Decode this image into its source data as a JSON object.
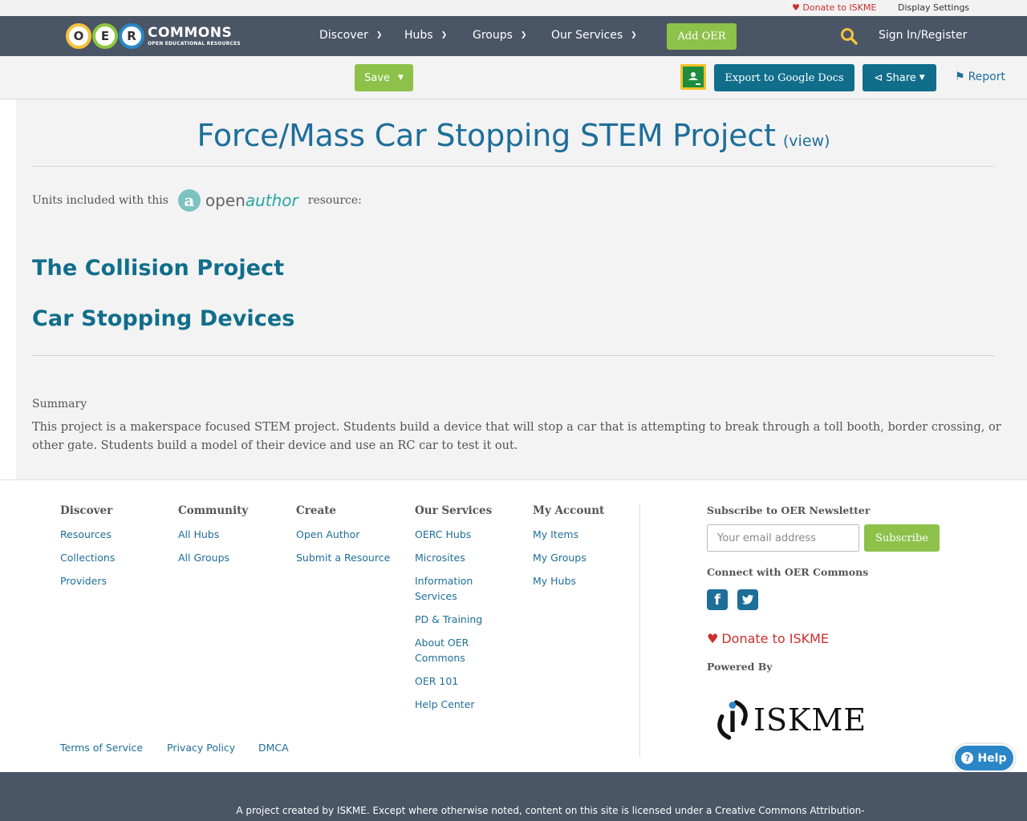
{
  "utility": {
    "donate_label": "Donate to ISKME",
    "display_settings_label": "Display Settings"
  },
  "brand": {
    "logo_letters": [
      "O",
      "E",
      "R"
    ],
    "logo_word": "COMMONS",
    "logo_tagline": "OPEN EDUCATIONAL RESOURCES"
  },
  "nav": {
    "items": [
      {
        "label": "Discover"
      },
      {
        "label": "Hubs"
      },
      {
        "label": "Groups"
      },
      {
        "label": "Our Services"
      }
    ],
    "add_oer_label": "Add OER",
    "sign_in_label": "Sign In/Register"
  },
  "toolbar": {
    "save_label": "Save",
    "export_label": "Export to Google Docs",
    "share_label": "Share",
    "report_label": "Report"
  },
  "resource": {
    "title": "Force/Mass Car Stopping STEM Project",
    "view_label": "(view)",
    "units_prefix": "Units included with this",
    "units_suffix": "resource:",
    "open_author_logo": {
      "part1": "open",
      "part2": "author"
    },
    "units": [
      {
        "label": "The Collision Project"
      },
      {
        "label": "Car Stopping Devices"
      }
    ],
    "summary_label": "Summary",
    "summary_text": "This project is a makerspace focused STEM project. Students build a device that will stop a car that is attempting to break through a toll booth, border crossing, or other gate. Students build a model of their device and use an RC car to test it out."
  },
  "footer": {
    "columns": [
      {
        "heading": "Discover",
        "links": [
          "Resources",
          "Collections",
          "Providers"
        ]
      },
      {
        "heading": "Community",
        "links": [
          "All Hubs",
          "All Groups"
        ]
      },
      {
        "heading": "Create",
        "links": [
          "Open Author",
          "Submit a Resource"
        ]
      },
      {
        "heading": "Our Services",
        "links": [
          "OERC Hubs",
          "Microsites",
          "Information Services",
          "PD & Training",
          "About OER Commons",
          "OER 101",
          "Help Center"
        ]
      },
      {
        "heading": "My Account",
        "links": [
          "My Items",
          "My Groups",
          "My Hubs"
        ]
      }
    ],
    "newsletter_heading": "Subscribe to OER Newsletter",
    "email_placeholder": "Your email address",
    "subscribe_label": "Subscribe",
    "connect_heading": "Connect with OER Commons",
    "donate_label": "Donate to ISKME",
    "powered_by_label": "Powered By",
    "powered_by_logo": "ISKME",
    "legal_links": [
      "Terms of Service",
      "Privacy Policy",
      "DMCA"
    ]
  },
  "help_label": "Help",
  "license_text": "A project created by ISKME. Except where otherwise noted, content on this site is licensed under a Creative Commons Attribution-",
  "colors": {
    "nav_bg": "#4a5565",
    "accent_green": "#8dc14a",
    "accent_teal": "#106e8b",
    "link_blue": "#1e6e9a",
    "donate_red": "#c9302c"
  }
}
